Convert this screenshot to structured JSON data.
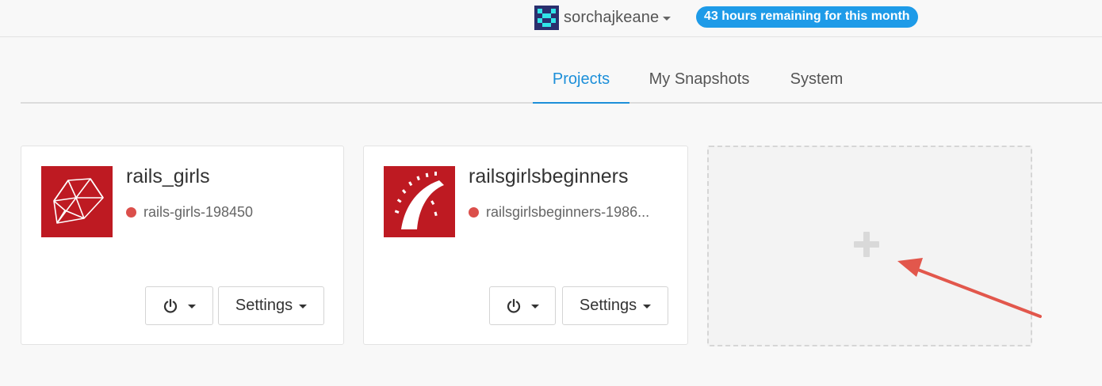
{
  "header": {
    "username": "sorchajkeane",
    "hours_badge": "43 hours remaining for this month",
    "avatar_icon": "pixel-avatar-icon",
    "dropdown_icon": "caret-down-icon"
  },
  "tabs": [
    {
      "label": "Projects",
      "active": true
    },
    {
      "label": "My Snapshots",
      "active": false
    },
    {
      "label": "System",
      "active": false
    }
  ],
  "projects": [
    {
      "name": "rails_girls",
      "status": "rails-girls-198450",
      "status_color": "#db4f4b",
      "logo_icon": "ruby-gem-icon",
      "power_icon": "power-icon",
      "settings_label": "Settings"
    },
    {
      "name": "railsgirlsbeginners",
      "status": "railsgirlsbeginners-1986...",
      "status_color": "#db4f4b",
      "logo_icon": "rails-logo-icon",
      "power_icon": "power-icon",
      "settings_label": "Settings"
    }
  ],
  "add_project": {
    "icon": "plus-icon"
  },
  "annotation": {
    "icon": "red-arrow-icon",
    "color": "#e2574c"
  },
  "colors": {
    "accent": "#1c8fd9",
    "badge": "#1e9be8",
    "logo_bg": "#be1a22"
  }
}
